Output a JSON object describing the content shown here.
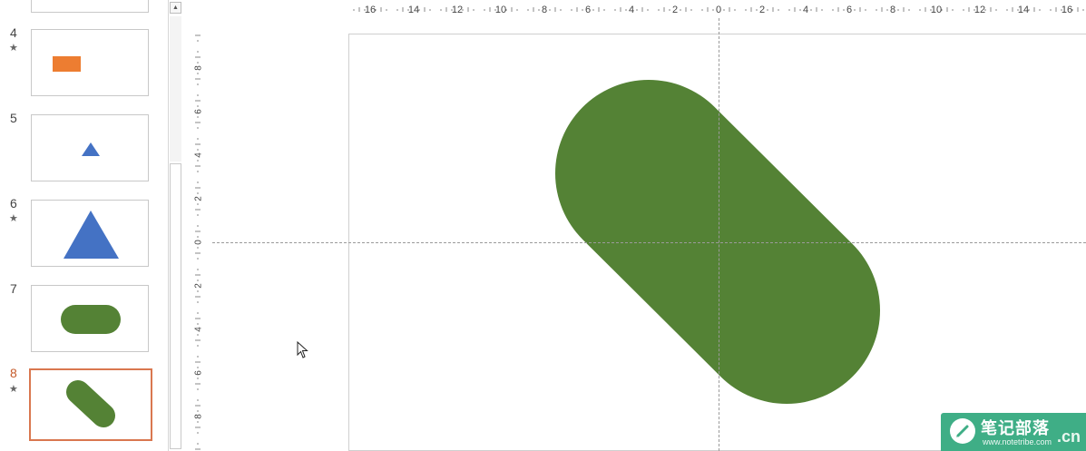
{
  "thumbnails": {
    "items": [
      {
        "number": "4",
        "star": "★",
        "shape": "rectangle",
        "color": "#ed7d31"
      },
      {
        "number": "5",
        "star": "",
        "shape": "small-triangle",
        "color": "#4472c4"
      },
      {
        "number": "6",
        "star": "★",
        "shape": "large-triangle",
        "color": "#4472c4"
      },
      {
        "number": "7",
        "star": "",
        "shape": "rounded-rectangle",
        "color": "#548235"
      },
      {
        "number": "8",
        "star": "★",
        "shape": "rotated-capsule",
        "color": "#548235",
        "selected": true
      }
    ]
  },
  "ruler": {
    "horizontal_ticks": [
      "16",
      "14",
      "12",
      "10",
      "8",
      "6",
      "4",
      "2",
      "0",
      "2",
      "4",
      "6",
      "8",
      "10",
      "12",
      "14",
      "16"
    ],
    "vertical_ticks": [
      "8",
      "6",
      "4",
      "2",
      "0",
      "2",
      "4",
      "6",
      "8"
    ]
  },
  "slide": {
    "shape": "rotated-capsule",
    "shape_color": "#548235"
  },
  "watermark": {
    "title": "笔记部落",
    "url": "www.notetribe.com",
    "suffix": ".cn",
    "color": "#3fae86"
  },
  "scrollbar": {
    "up_arrow": "▲"
  }
}
